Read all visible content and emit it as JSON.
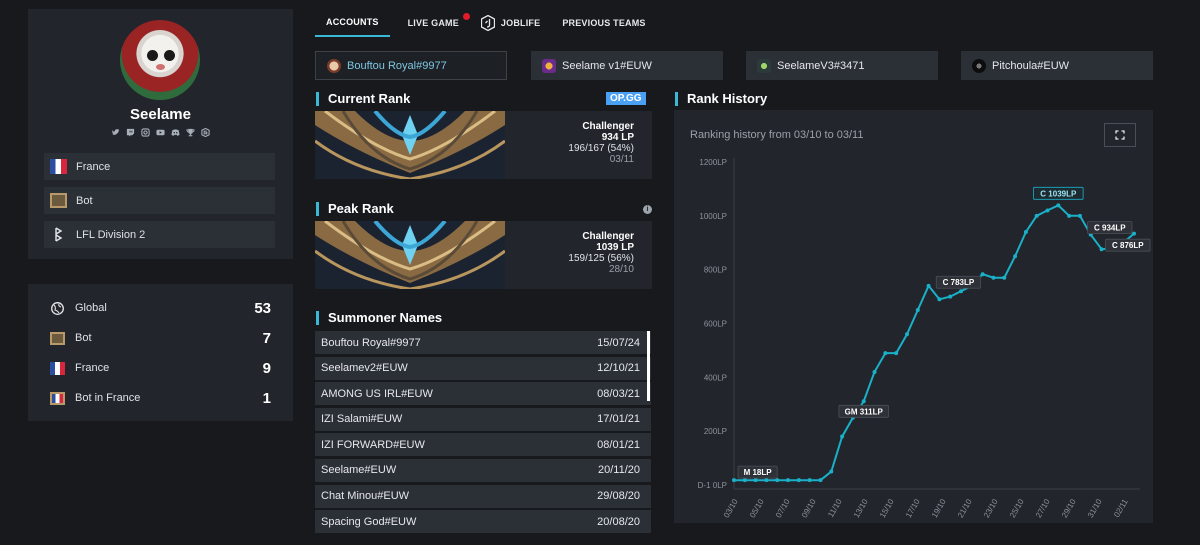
{
  "profile": {
    "name": "Seelame",
    "socials": [
      "twitter-icon",
      "twitch-icon",
      "instagram-icon",
      "youtube-icon",
      "discord-icon",
      "trophy-icon",
      "leaguepedia-icon"
    ],
    "info": [
      {
        "label": "France",
        "icon": "france-flag-icon"
      },
      {
        "label": "Bot",
        "icon": "bot-lane-icon"
      },
      {
        "label": "LFL Division 2",
        "icon": "lfl-icon"
      }
    ]
  },
  "ladder": [
    {
      "label": "Global",
      "value": "53",
      "icon": "globe-icon"
    },
    {
      "label": "Bot",
      "value": "7",
      "icon": "bot-lane-icon"
    },
    {
      "label": "France",
      "value": "9",
      "icon": "france-flag-icon"
    },
    {
      "label": "Bot in France",
      "value": "1",
      "icon": "bot-in-france-icon"
    }
  ],
  "tabs": {
    "accounts": "ACCOUNTS",
    "live_game": "LIVE GAME",
    "joblife": "JOBLIFE",
    "previous_teams": "PREVIOUS TEAMS"
  },
  "accounts": [
    {
      "label": "Bouftou Royal#9977",
      "active": true
    },
    {
      "label": "Seelame v1#EUW",
      "active": false
    },
    {
      "label": "SeelameV3#3471",
      "active": false
    },
    {
      "label": "Pitchoula#EUW",
      "active": false
    }
  ],
  "current_rank": {
    "title": "Current Rank",
    "badge": "OP.GG",
    "tier": "Challenger",
    "lp": "934 LP",
    "record": "196/167 (54%)",
    "date": "03/11"
  },
  "peak_rank": {
    "title": "Peak Rank",
    "tier": "Challenger",
    "lp": "1039 LP",
    "record": "159/125 (56%)",
    "date": "28/10"
  },
  "summoner_names": {
    "title": "Summoner Names",
    "rows": [
      {
        "name": "Bouftou Royal#9977",
        "date": "15/07/24"
      },
      {
        "name": "Seelamev2#EUW",
        "date": "12/10/21"
      },
      {
        "name": "AMONG US IRL#EUW",
        "date": "08/03/21"
      },
      {
        "name": "IZI Salami#EUW",
        "date": "17/01/21"
      },
      {
        "name": "IZI FORWARD#EUW",
        "date": "08/01/21"
      },
      {
        "name": "Seelame#EUW",
        "date": "20/11/20"
      },
      {
        "name": "Chat Minou#EUW",
        "date": "29/08/20"
      },
      {
        "name": "Spacing God#EUW",
        "date": "20/08/20"
      }
    ]
  },
  "rank_history": {
    "title": "Rank History",
    "subtitle": "Ranking history from 03/10 to 03/11"
  },
  "chart_data": {
    "type": "line",
    "ylim": [
      0,
      1200
    ],
    "y_ticks": [
      0,
      200,
      400,
      600,
      800,
      1000,
      1200
    ],
    "y_tick_labels": [
      "D-1 0LP",
      "200LP",
      "400LP",
      "600LP",
      "800LP",
      "1000LP",
      "1200LP"
    ],
    "x_tick_labels": [
      "03/10",
      "05/10",
      "07/10",
      "09/10",
      "11/10",
      "13/10",
      "15/10",
      "17/10",
      "19/10",
      "21/10",
      "23/10",
      "25/10",
      "27/10",
      "29/10",
      "31/10",
      "02/11"
    ],
    "x_range": [
      0,
      31
    ],
    "color": "#1ab0c8",
    "series": [
      {
        "values": [
          [
            0,
            18
          ],
          [
            1,
            18
          ],
          [
            2,
            18
          ],
          [
            3,
            18
          ],
          [
            4,
            18
          ],
          [
            5,
            18
          ],
          [
            6,
            18
          ],
          [
            7,
            18
          ],
          [
            8,
            18
          ],
          [
            9,
            50
          ],
          [
            10,
            180
          ],
          [
            11,
            250
          ],
          [
            12,
            311
          ],
          [
            13,
            420
          ],
          [
            14,
            490
          ],
          [
            15,
            490
          ],
          [
            16,
            560
          ],
          [
            17,
            650
          ],
          [
            18,
            740
          ],
          [
            19,
            690
          ],
          [
            20,
            700
          ],
          [
            21,
            720
          ],
          [
            22,
            740
          ],
          [
            23,
            783
          ],
          [
            24,
            770
          ],
          [
            25,
            770
          ],
          [
            26,
            850
          ],
          [
            27,
            940
          ],
          [
            28,
            1000
          ],
          [
            29,
            1020
          ],
          [
            30,
            1039
          ],
          [
            31,
            1000
          ],
          [
            32,
            1000
          ],
          [
            33,
            930
          ],
          [
            34,
            876
          ],
          [
            35,
            880
          ],
          [
            36,
            900
          ],
          [
            37,
            934
          ]
        ]
      }
    ],
    "annotations": [
      {
        "label": "M 18LP",
        "x": 0,
        "y": 18
      },
      {
        "label": "GM 311LP",
        "x": 12,
        "y": 311
      },
      {
        "label": "C 783LP",
        "x": 23,
        "y": 783
      },
      {
        "label": "C 1039LP",
        "x": 30,
        "y": 1039,
        "highlight": true
      },
      {
        "label": "C 934LP",
        "x": 37,
        "y": 934
      },
      {
        "label": "C 876LP",
        "x": 34,
        "y": 876
      }
    ]
  }
}
